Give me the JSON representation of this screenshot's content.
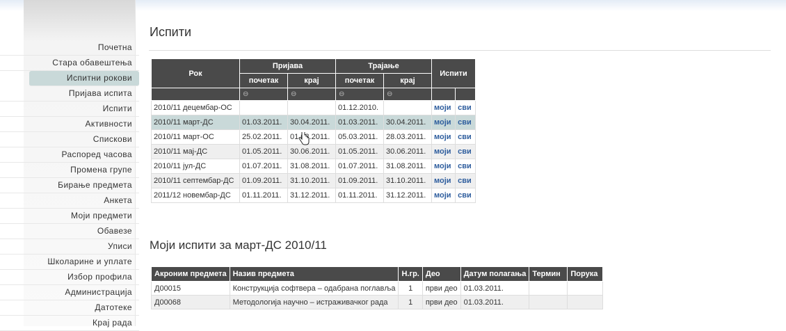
{
  "nav": [
    {
      "label": "Почетна"
    },
    {
      "label": "Стара обавештења"
    },
    {
      "label": "Испитни рокови",
      "active": true
    },
    {
      "label": "Пријава испита"
    },
    {
      "label": "Испити"
    },
    {
      "label": "Активности"
    },
    {
      "label": "Спискови"
    },
    {
      "label": "Распоред часова"
    },
    {
      "label": "Промена групе"
    },
    {
      "label": "Бирање предмета"
    },
    {
      "label": "Анкета"
    },
    {
      "label": "Моји предмети"
    },
    {
      "label": "Обавезе"
    },
    {
      "label": "Уписи"
    },
    {
      "label": "Школарине и уплате"
    },
    {
      "label": "Избор профила"
    },
    {
      "label": "Администрација"
    },
    {
      "label": "Датотеке"
    },
    {
      "label": "Крај рада"
    }
  ],
  "page_title": "Испити",
  "exams_table": {
    "headers": {
      "rok": "Рок",
      "prijava": "Пријава",
      "trajanje": "Трајање",
      "ispiti": "Испити",
      "pocetak": "почетак",
      "kraj": "крај",
      "sort_symbol": "⊖"
    },
    "rows": [
      {
        "rok": "2010/11 децембар-ОС",
        "p_start": "",
        "p_end": "",
        "t_start": "01.12.2010.",
        "t_end": "",
        "moji": "моји",
        "svi": "сви"
      },
      {
        "rok": "2010/11 март-ДС",
        "p_start": "01.03.2011.",
        "p_end": "30.04.2011.",
        "t_start": "01.03.2011.",
        "t_end": "30.04.2011.",
        "moji": "моји",
        "svi": "сви"
      },
      {
        "rok": "2010/11 март-ОС",
        "p_start": "25.02.2011.",
        "p_end": "01.03.2011.",
        "t_start": "05.03.2011.",
        "t_end": "28.03.2011.",
        "moji": "моји",
        "svi": "сви"
      },
      {
        "rok": "2010/11 мај-ДС",
        "p_start": "01.05.2011.",
        "p_end": "30.06.2011.",
        "t_start": "01.05.2011.",
        "t_end": "30.06.2011.",
        "moji": "моји",
        "svi": "сви"
      },
      {
        "rok": "2010/11 јул-ДС",
        "p_start": "01.07.2011.",
        "p_end": "31.08.2011.",
        "t_start": "01.07.2011.",
        "t_end": "31.08.2011.",
        "moji": "моји",
        "svi": "сви"
      },
      {
        "rok": "2010/11 септембар-ДС",
        "p_start": "01.09.2011.",
        "p_end": "31.10.2011.",
        "t_start": "01.09.2011.",
        "t_end": "31.10.2011.",
        "moji": "моји",
        "svi": "сви"
      },
      {
        "rok": "2011/12 новембар-ДС",
        "p_start": "01.11.2011.",
        "p_end": "31.12.2011.",
        "t_start": "01.11.2011.",
        "t_end": "31.12.2011.",
        "moji": "моји",
        "svi": "сви"
      }
    ]
  },
  "my_exams_title": "Моји испити за март-ДС 2010/11",
  "my_exams_table": {
    "headers": [
      "Акроним предмета",
      "Назив предмета",
      "Н.гр.",
      "Део",
      "Датум полагања",
      "Термин",
      "Порука"
    ],
    "rows": [
      [
        "Д00015",
        "Конструкција софтвера – одабрана поглавља",
        "1",
        "први део",
        "01.03.2011.",
        "",
        ""
      ],
      [
        "Д00068",
        "Методологија научно – истраживачког рада",
        "1",
        "први део",
        "01.03.2011.",
        "",
        ""
      ]
    ]
  },
  "colors": {
    "header_bg": "#4a4a4a",
    "highlight": "#c9d9d9",
    "link": "#2f5e9e"
  }
}
